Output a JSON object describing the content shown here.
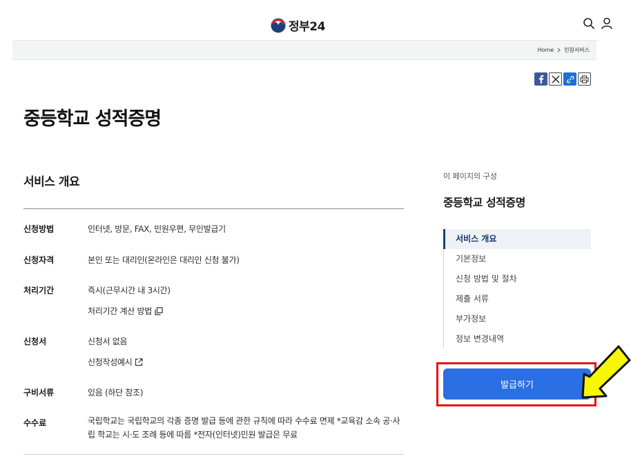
{
  "header": {
    "logo_text": "정부24",
    "search_icon": "search-icon",
    "user_icon": "user-icon"
  },
  "breadcrumb": {
    "home": "Home",
    "current": "민원서비스"
  },
  "share": [
    "facebook-icon",
    "x-icon",
    "link-icon",
    "print-icon"
  ],
  "page_title": "중등학교 성적증명",
  "overview": {
    "title": "서비스 개요",
    "rows": [
      {
        "label": "신청방법",
        "value": "인터넷, 방문, FAX, 민원우편, 무인발급기"
      },
      {
        "label": "신청자격",
        "value": "본인 또는 대리인(온라인은 대리인 신청 불가)"
      },
      {
        "label": "처리기간",
        "value": "즉시(근무시간 내 3시간)",
        "link": "처리기간 계산 방법"
      },
      {
        "label": "신청서",
        "value": "신청서 없음",
        "link": "신청작성예시"
      },
      {
        "label": "구비서류",
        "value": "있음 (하단 참조)"
      },
      {
        "label": "수수료",
        "value": "국립학교는 국립학교의 각종 증명 발급 등에 관한 규칙에 따라 수수료 면제 *교육감 소속 공·사립 학교는 시·도 조례 등에 따름 *전자(인터넷)민원 발급은 무료"
      }
    ]
  },
  "toc": {
    "caption": "이 페이지의 구성",
    "title": "중등학교 성적증명",
    "items": [
      "서비스 개요",
      "기본정보",
      "신청 방법 및 절차",
      "제출 서류",
      "부가정보",
      "정보 변경내역"
    ],
    "active_index": 0
  },
  "issue_button": "발급하기",
  "colors": {
    "primary": "#2a6fe3",
    "highlight": "#ea0f0f",
    "arrow": "#f7f700",
    "toc_active": "#1d3f78"
  }
}
